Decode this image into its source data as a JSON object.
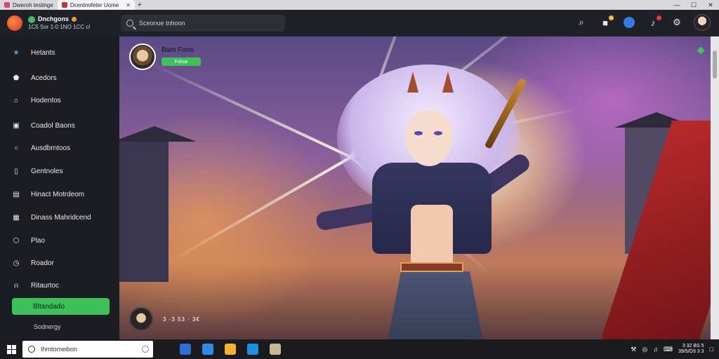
{
  "browser": {
    "tabs": [
      {
        "label": "Dweroh testinge"
      },
      {
        "label": "Dcentnofeter Uome",
        "active": true
      }
    ],
    "new_tab_symbol": "+",
    "window_controls": [
      "—",
      "☐",
      "✕"
    ]
  },
  "header": {
    "brand_name": "Dnchgons",
    "brand_sub": "1C5 Sor  1-0  1NO 1CC cl",
    "search_placeholder": "Sceonue tnhoon",
    "icons": [
      "help-icon",
      "gift-icon",
      "chat-icon",
      "notifications-icon",
      "settings-icon",
      "profile-avatar"
    ]
  },
  "sidebar": {
    "items": [
      {
        "label": "Hetants",
        "icon": "star-icon"
      },
      {
        "label": "Acedors",
        "icon": "shield-icon"
      },
      {
        "label": "Hodentos",
        "icon": "home-icon"
      },
      {
        "label": "Coadol Baons",
        "icon": "badge-icon"
      },
      {
        "label": "Ausdbrntoos",
        "icon": "chat-icon"
      },
      {
        "label": "Gentnoles",
        "icon": "bookmark-icon"
      },
      {
        "label": "Hinact Motrdeom",
        "icon": "book-icon"
      },
      {
        "label": "Dinass Mahridcend",
        "icon": "gallery-icon"
      },
      {
        "label": "Plao",
        "icon": "hexagon-icon"
      },
      {
        "label": "Roador",
        "icon": "clock-icon"
      },
      {
        "label": "Ritaurtoc",
        "icon": "bell-icon"
      }
    ],
    "cta_label": "Bltandado",
    "footer": "Sodnergy"
  },
  "art": {
    "creator_name": "Bam Fons",
    "creator_tag": "Folow",
    "viewer_stats": "3 ·3 53 · 3€"
  },
  "taskbar": {
    "search_placeholder": "Ihmtomeibon",
    "apps": [
      {
        "icon": "files-icon",
        "color": "#2d6fd1"
      },
      {
        "icon": "edge-icon",
        "color": "#2f8ae6"
      },
      {
        "icon": "chrome-icon",
        "color": "#f2b233"
      },
      {
        "icon": "store-icon",
        "color": "#1e90e0"
      },
      {
        "icon": "photos-icon",
        "color": "#c8b89a"
      }
    ],
    "clock_time": "3 32 BS 5",
    "clock_date": "39/5/O3 3 3"
  }
}
